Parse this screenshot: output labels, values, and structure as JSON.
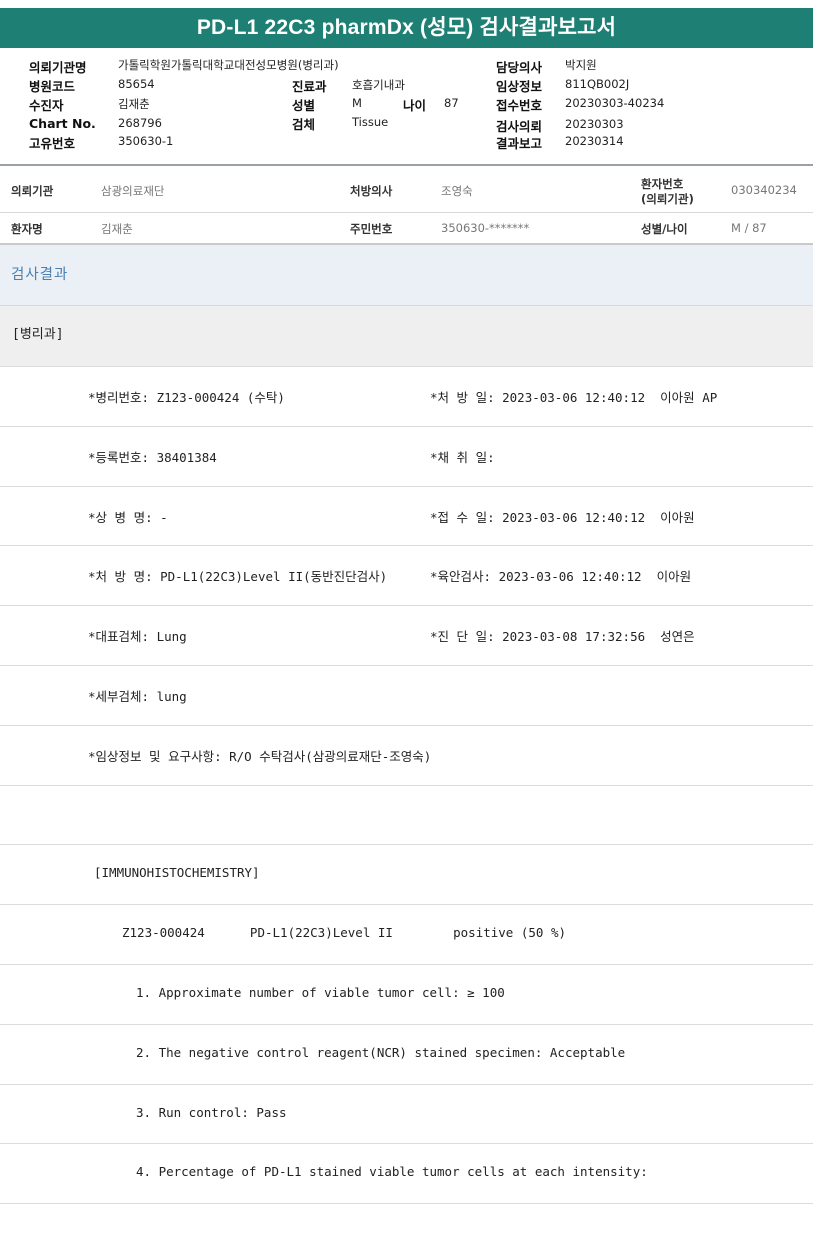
{
  "title": "PD-L1 22C3 pharmDx (성모) 검사결과보고서",
  "header": {
    "institution_label": "의뢰기관명",
    "institution_value": "가톨릭학원가톨릭대학교대전성모병원(병리과)",
    "hospital_code_label": "병원코드",
    "hospital_code_value": "85654",
    "examinee_label": "수진자",
    "examinee_value": "김재춘",
    "chart_no_label": "Chart No.",
    "chart_no_value": "268796",
    "unique_no_label": "고유번호",
    "unique_no_value": "350630-1",
    "dept_label": "진료과",
    "dept_value": "호흡기내과",
    "sex_label": "성별",
    "sex_value": "M",
    "age_label": "나이",
    "age_value": "87",
    "specimen_label": "검체",
    "specimen_value": "Tissue",
    "doctor_label": "담당의사",
    "doctor_value": "박지원",
    "clinical_label": "임상정보",
    "clinical_value": "811QB002J",
    "receipt_label": "접수번호",
    "receipt_value": "20230303-40234",
    "request_label": "검사의뢰",
    "request_value": "20230303",
    "report_label": "결과보고",
    "report_value": "20230314"
  },
  "patient": {
    "inst_label": "의뢰기관",
    "inst_value": "삼광의료재단",
    "prescriber_label": "처방의사",
    "prescriber_value": "조영숙",
    "pid_label_1": "환자번호",
    "pid_label_2": "(의뢰기관)",
    "pid_value": "030340234",
    "name_label": "환자명",
    "name_value": "김재춘",
    "rrn_label": "주민번호",
    "rrn_value": "350630-*******",
    "sexage_label": "성별/나이",
    "sexage_value": "M / 87"
  },
  "section_title": "검사결과",
  "department": "[병리과]",
  "report_lines": [
    {
      "left": "*병리번호: Z123-000424 (수탁)",
      "right": "*처 방 일: 2023-03-06 12:40:12  이아원 AP"
    },
    {
      "left": "*등록번호: 38401384",
      "right": "*채 취 일:"
    },
    {
      "left": "*상 병 명: -",
      "right": "*접 수 일: 2023-03-06 12:40:12  이아원"
    },
    {
      "left": "*처 방 명: PD-L1(22C3)Level II(동반진단검사)",
      "right": "*육안검사: 2023-03-06 12:40:12  이아원"
    },
    {
      "left": "*대표검체: Lung",
      "right": "*진 단 일: 2023-03-08 17:32:56  성연은"
    },
    {
      "left": "*세부검체: lung",
      "right": ""
    },
    {
      "left": "*임상정보 및 요구사항: R/O 수탁검사(삼광의료재단-조영숙)",
      "right": ""
    },
    {
      "left": "",
      "right": ""
    },
    {
      "left": "[IMMUNOHISTOCHEMISTRY]",
      "right": ""
    },
    {
      "left": "Z123-000424      PD-L1(22C3)Level II        positive (50 %)",
      "right": ""
    },
    {
      "left": "1. Approximate number of viable tumor cell: ≥ 100",
      "right": ""
    },
    {
      "left": "2. The negative control reagent(NCR) stained specimen: Acceptable",
      "right": ""
    },
    {
      "left": "3. Run control: Pass",
      "right": ""
    },
    {
      "left": "4. Percentage of PD-L1 stained viable tumor cells at each intensity:",
      "right": ""
    }
  ]
}
